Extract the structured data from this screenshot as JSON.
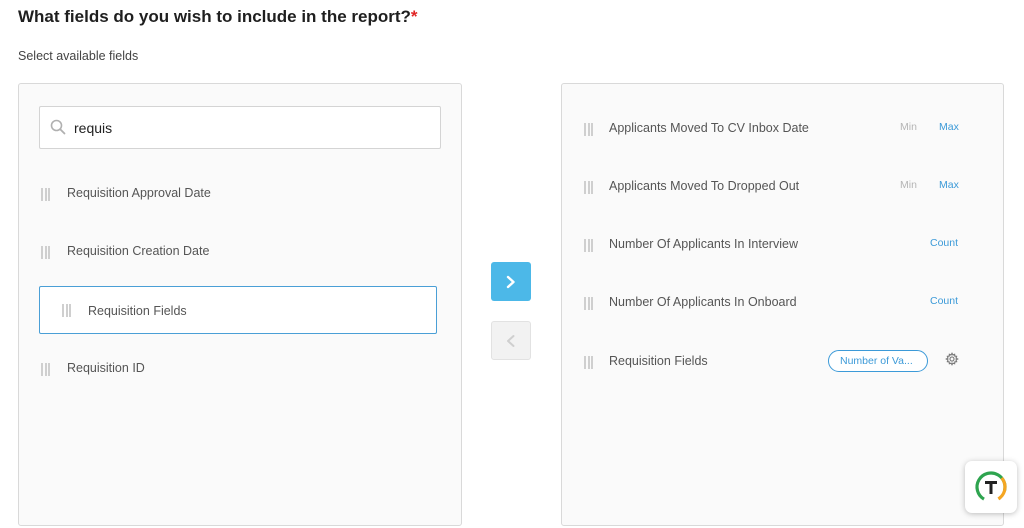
{
  "header": {
    "title": "What fields do you wish to include in the report?",
    "required_mark": "*",
    "subtitle": "Select available fields"
  },
  "search": {
    "value": "requis",
    "icon": "search-icon"
  },
  "available_fields": [
    {
      "label": "Requisition Approval Date",
      "selected": false
    },
    {
      "label": "Requisition Creation Date",
      "selected": false
    },
    {
      "label": "Requisition Fields",
      "selected": true
    },
    {
      "label": "Requisition ID",
      "selected": false
    }
  ],
  "move_buttons": {
    "add_icon": "chevron-right-icon",
    "remove_icon": "chevron-left-icon"
  },
  "selected_fields": [
    {
      "label": "Applicants Moved To CV Inbox Date",
      "aggregations": [
        {
          "label": "Min",
          "active": false
        },
        {
          "label": "Max",
          "active": true
        }
      ]
    },
    {
      "label": "Applicants Moved To Dropped Out",
      "aggregations": [
        {
          "label": "Min",
          "active": false
        },
        {
          "label": "Max",
          "active": true
        }
      ]
    },
    {
      "label": "Number Of Applicants In Interview",
      "aggregations": [
        {
          "label": "Count",
          "active": true
        }
      ]
    },
    {
      "label": "Number Of Applicants In Onboard",
      "aggregations": [
        {
          "label": "Count",
          "active": true
        }
      ]
    },
    {
      "label": "Requisition Fields",
      "value_pill": "Number of Va...",
      "settings_icon": "gear-icon"
    }
  ],
  "colors": {
    "accent": "#3c9ad8",
    "add_button": "#4cb8e8",
    "required": "#e02424",
    "logo_green": "#2ea44f",
    "logo_orange": "#f5a623"
  },
  "widget": {
    "icon": "t-logo-icon"
  }
}
